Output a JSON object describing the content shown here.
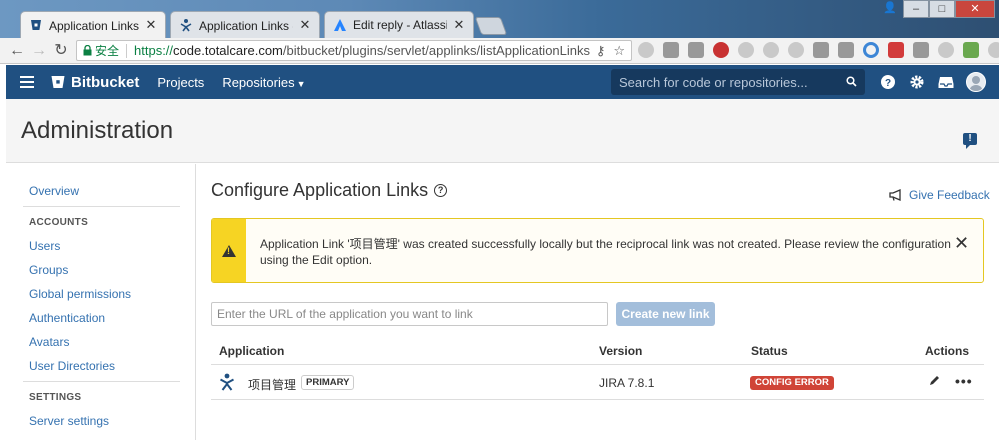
{
  "browser": {
    "tabs": [
      {
        "title": "Application Links - 代码",
        "active": true
      },
      {
        "title": "Application Links - 项目",
        "active": false
      },
      {
        "title": "Edit reply - Atlassian C",
        "active": false
      }
    ],
    "tab_close": "✕",
    "secure_label": "安全",
    "url_scheme": "https://",
    "url_host": "code.totalcare.com",
    "url_path": "/bitbucket/plugins/servlet/applinks/listApplicationLinks"
  },
  "header": {
    "logo_text": "Bitbucket",
    "nav": [
      {
        "label": "Projects"
      },
      {
        "label": "Repositories"
      }
    ],
    "search_placeholder": "Search for code or repositories...",
    "brand_color": "#205081"
  },
  "page": {
    "title": "Administration"
  },
  "sidebar": {
    "overview": "Overview",
    "accounts_heading": "ACCOUNTS",
    "accounts": [
      "Users",
      "Groups",
      "Global permissions",
      "Authentication",
      "Avatars",
      "User Directories"
    ],
    "settings_heading": "SETTINGS",
    "settings": [
      "Server settings"
    ]
  },
  "main": {
    "title": "Configure Application Links",
    "give_feedback": "Give Feedback",
    "warning": "Application Link '项目管理' was created successfully locally but the reciprocal link was not created. Please review the configuration using the Edit option.",
    "url_placeholder": "Enter the URL of the application you want to link",
    "create_button": "Create new link",
    "columns": {
      "application": "Application",
      "version": "Version",
      "status": "Status",
      "actions": "Actions"
    },
    "rows": [
      {
        "application": "项目管理",
        "badge": "PRIMARY",
        "version": "JIRA 7.8.1",
        "status": "CONFIG ERROR"
      }
    ],
    "status_error_color": "#d04437",
    "warning_color": "#f6d423"
  }
}
